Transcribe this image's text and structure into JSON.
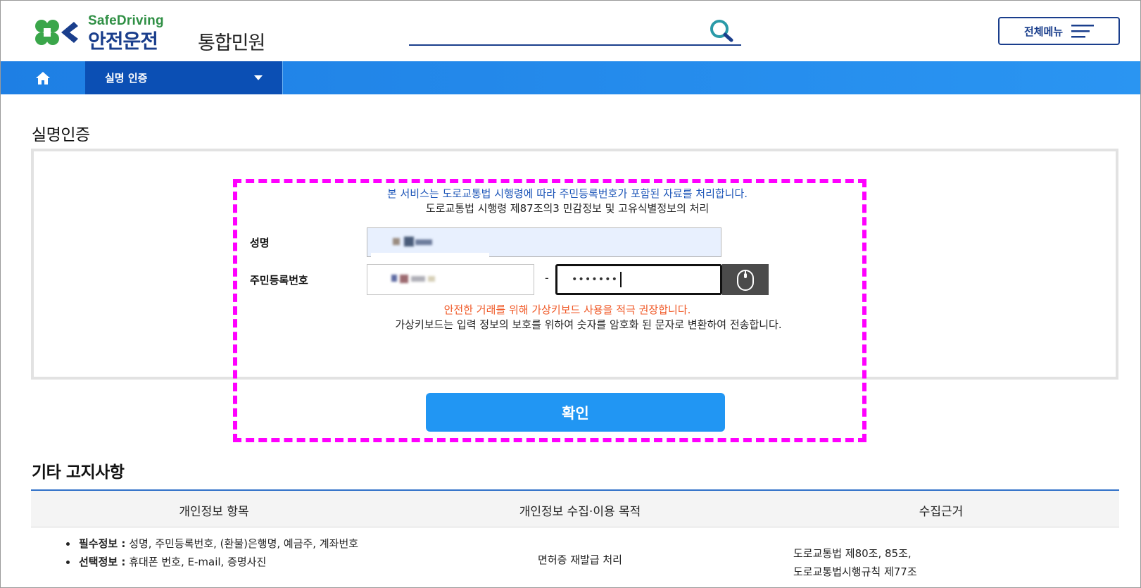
{
  "header": {
    "logo_sub": "SafeDriving",
    "logo_main": "안전운전",
    "logo_main_2": "통합민원",
    "search_placeholder": "",
    "menu_label": "전체메뉴"
  },
  "nav": {
    "home_icon": "home-icon",
    "selected": "실명 인증"
  },
  "page_title": "실명인증",
  "form": {
    "notice_blue": "본 서비스는 도로교통법 시행령에 따라 주민등록번호가 포함된 자료를 처리합니다.",
    "notice_black": "도로교통법 시행령 제87조의3 민감정보 및 고유식별정보의 처리",
    "name_label": "성명",
    "rrn_label": "주민등록번호",
    "rrn_dash": "-",
    "rrn_back_value": "•••••••",
    "notice_orange": "안전한 거래를 위해 가상키보드 사용을 적극 권장합니다.",
    "notice_black2": "가상키보드는 입력 정보의 보호를 위하여 숫자를 암호화 된 문자로 변환하여 전송합니다.",
    "confirm_label": "확인"
  },
  "section_title": "기타 고지사항",
  "table": {
    "headers": [
      "개인정보 항목",
      "개인정보 수집·이용 목적",
      "수집근거"
    ],
    "row": {
      "items": [
        {
          "strong": "필수정보 :",
          "text": " 성명, 주민등록번호, (환불)은행명, 예금주, 계좌번호"
        },
        {
          "strong": "선택정보 :",
          "text": " 휴대폰 번호, E-mail, 증명사진"
        }
      ],
      "purpose": "면허증 재발급 처리",
      "basis": [
        "도로교통법 제80조, 85조,",
        "도로교통법시행규칙 제77조"
      ]
    }
  },
  "colors": {
    "brand_blue": "#1a3e8c",
    "nav_blue": "#2196f3",
    "nav_dark": "#0b4fb4",
    "highlight": "#ff00ff",
    "warning": "#f05a28",
    "logo_green": "#2f8f44"
  }
}
